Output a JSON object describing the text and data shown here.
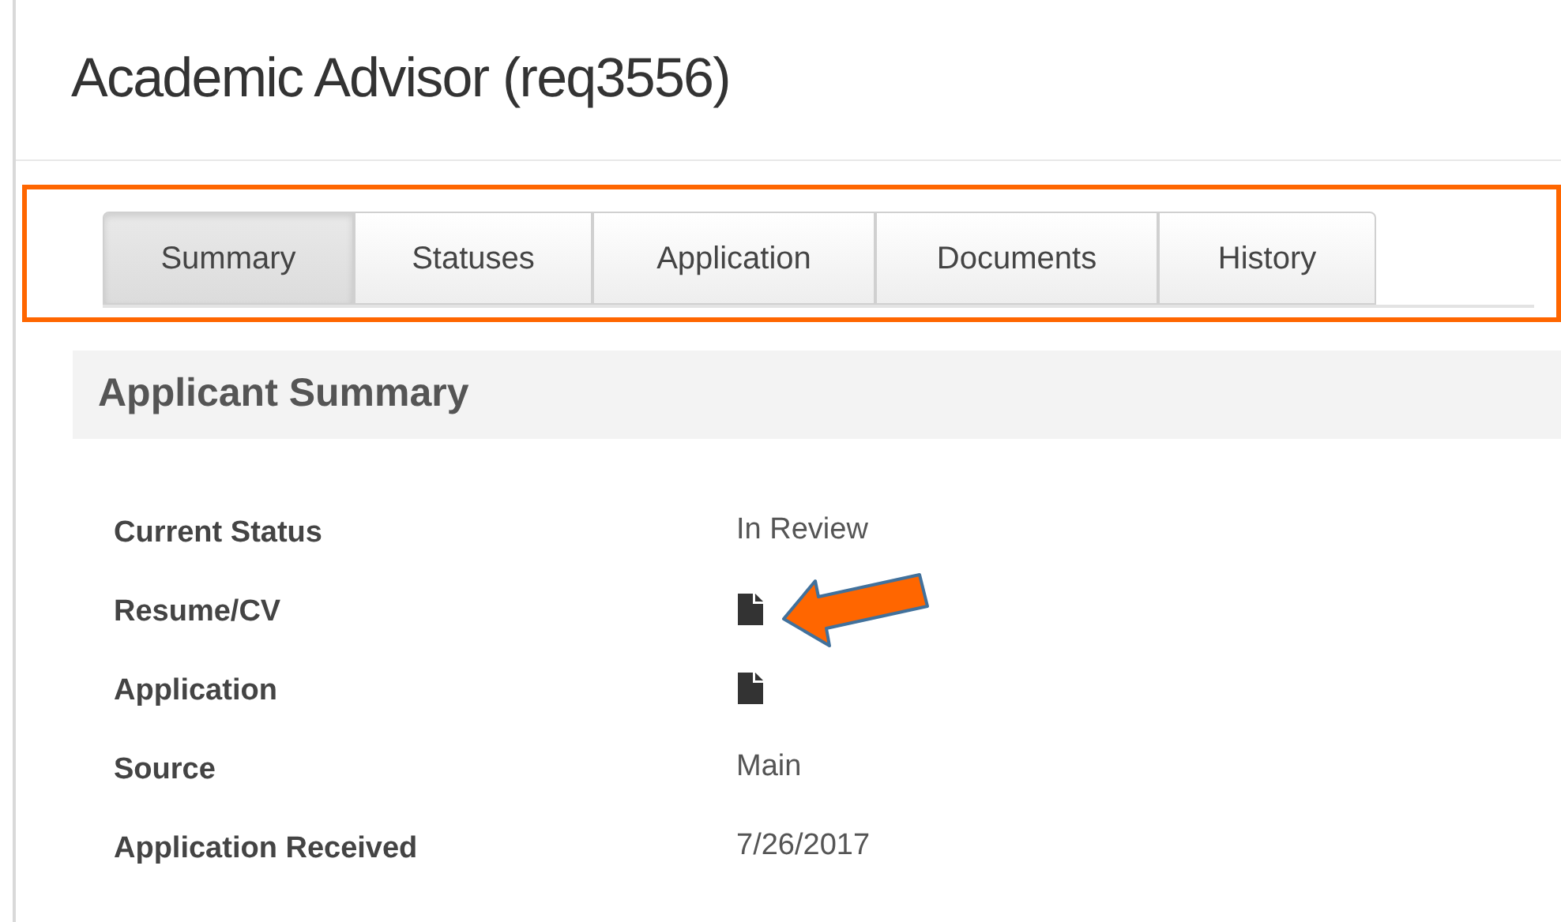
{
  "title": "Academic Advisor (req3556)",
  "tabs": [
    {
      "label": "Summary",
      "selected": true
    },
    {
      "label": "Statuses",
      "selected": false
    },
    {
      "label": "Application",
      "selected": false
    },
    {
      "label": "Documents",
      "selected": false
    },
    {
      "label": "History",
      "selected": false
    }
  ],
  "tabs_highlighted": true,
  "section": {
    "title": "Applicant Summary",
    "rows": [
      {
        "label": "Current Status",
        "kind": "text",
        "value": "In Review",
        "pointed": false
      },
      {
        "label": "Resume/CV",
        "kind": "document",
        "pointed": true
      },
      {
        "label": "Application",
        "kind": "document",
        "pointed": false
      },
      {
        "label": "Source",
        "kind": "text",
        "value": "Main",
        "pointed": false
      },
      {
        "label": "Application Received",
        "kind": "text",
        "value": "7/26/2017",
        "pointed": false
      }
    ]
  }
}
